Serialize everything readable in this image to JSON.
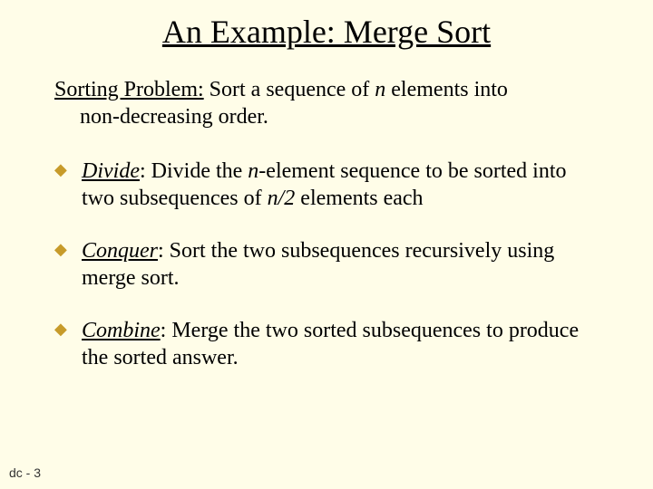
{
  "title": "An Example:  Merge Sort",
  "problem": {
    "lead": "Sorting Problem:",
    "text1": " Sort a sequence of ",
    "italic1": "n",
    "text2": " elements into",
    "line2": "non-decreasing order."
  },
  "bullets": [
    {
      "lead": "Divide",
      "colon": ":",
      "t1": "  Divide the ",
      "i1": "n",
      "t2": "-element sequence to be sorted into two subsequences of ",
      "i2": "n/2",
      "t3": " elements each"
    },
    {
      "lead": "Conquer",
      "colon": ":",
      "t1": "  Sort the two subsequences recursively using merge sort.",
      "i1": "",
      "t2": "",
      "i2": "",
      "t3": ""
    },
    {
      "lead": "Combine",
      "colon": ":",
      "t1": "  Merge the two sorted subsequences to produce the sorted answer.",
      "i1": "",
      "t2": "",
      "i2": "",
      "t3": ""
    }
  ],
  "footer": "dc - 3"
}
